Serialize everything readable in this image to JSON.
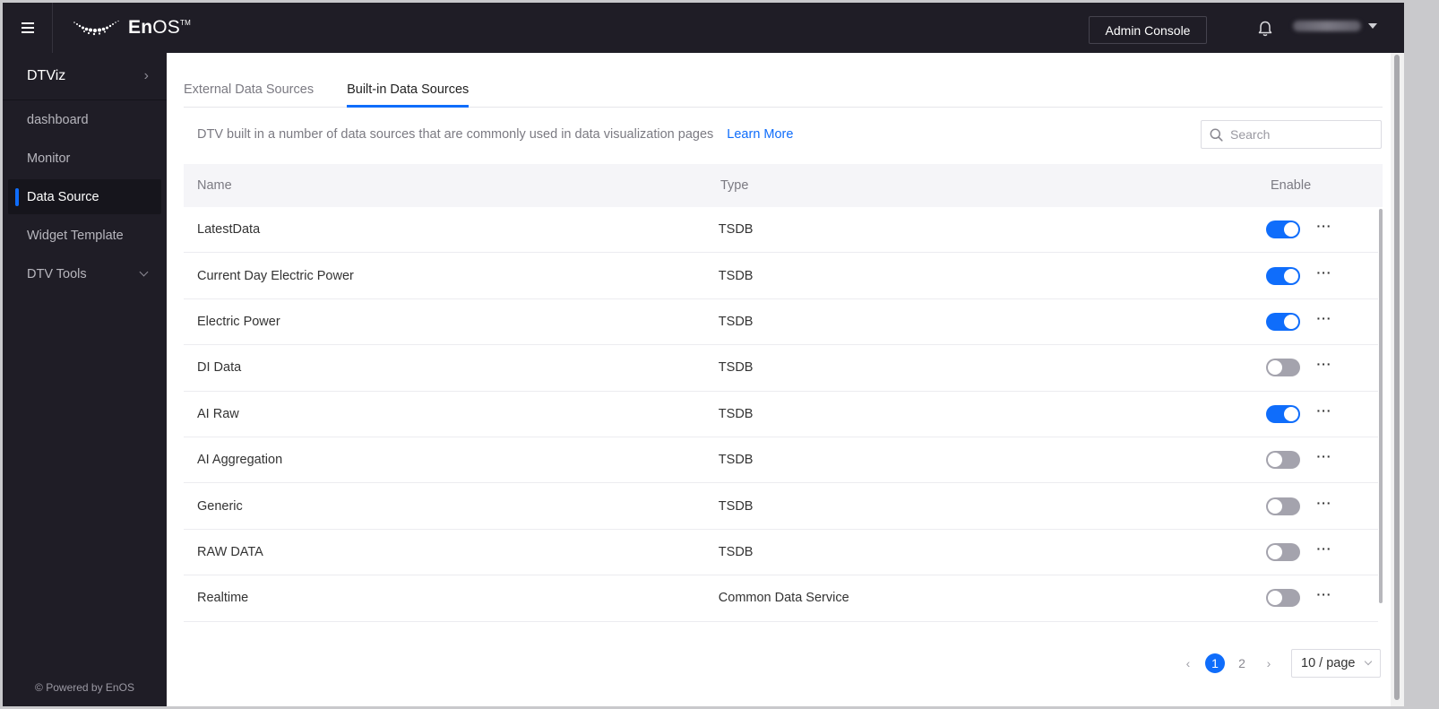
{
  "header": {
    "menu_icon": "hamburger-icon",
    "logo_text_bold": "En",
    "logo_text_light": "OS",
    "logo_tm": "TM",
    "admin_console_label": "Admin Console",
    "notification_icon": "bell-icon",
    "user_name": "(blurred)",
    "user_menu_icon": "caret-down-icon"
  },
  "sidebar": {
    "app_title": "DTViz",
    "app_title_icon": "chevron-right-icon",
    "items": [
      {
        "label": "dashboard",
        "active": false
      },
      {
        "label": "Monitor",
        "active": false
      },
      {
        "label": "Data Source",
        "active": true
      },
      {
        "label": "Widget Template",
        "active": false
      },
      {
        "label": "DTV Tools",
        "active": false,
        "expandable": true
      }
    ],
    "footer": "© Powered by EnOS"
  },
  "main": {
    "tabs": [
      {
        "label": "External Data Sources",
        "active": false
      },
      {
        "label": "Built-in Data Sources",
        "active": true
      }
    ],
    "description": "DTV built in a number of data sources that are commonly used in data visualization pages",
    "learn_more_label": "Learn More",
    "search": {
      "placeholder": "Search",
      "value": ""
    },
    "table": {
      "columns": [
        "Name",
        "Type",
        "Enable"
      ],
      "rows": [
        {
          "name": "LatestData",
          "type": "TSDB",
          "enabled": true
        },
        {
          "name": "Current Day Electric Power",
          "type": "TSDB",
          "enabled": true
        },
        {
          "name": "Electric Power",
          "type": "TSDB",
          "enabled": true
        },
        {
          "name": "DI Data",
          "type": "TSDB",
          "enabled": false
        },
        {
          "name": "AI Raw",
          "type": "TSDB",
          "enabled": true
        },
        {
          "name": "AI Aggregation",
          "type": "TSDB",
          "enabled": false
        },
        {
          "name": "Generic",
          "type": "TSDB",
          "enabled": false
        },
        {
          "name": "RAW DATA",
          "type": "TSDB",
          "enabled": false
        },
        {
          "name": "Realtime",
          "type": "Common Data Service",
          "enabled": false
        }
      ],
      "row_action_label": "···"
    },
    "pagination": {
      "prev": "‹",
      "next": "›",
      "pages": [
        "1",
        "2"
      ],
      "current_page": "1",
      "page_size_label": "10 / page"
    }
  },
  "colors": {
    "accent": "#0f6dfb",
    "header_bg": "#1f1d26",
    "toggle_off": "#a4a3ad"
  }
}
